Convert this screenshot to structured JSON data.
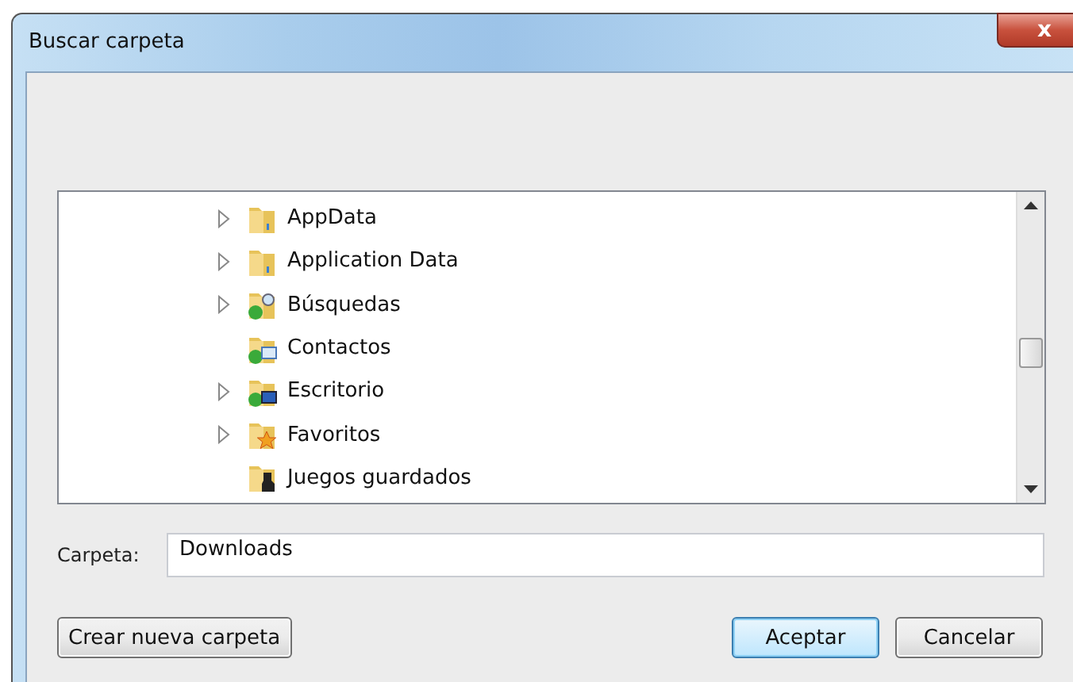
{
  "window": {
    "title": "Buscar carpeta",
    "close": "x"
  },
  "tree": {
    "items": [
      {
        "label": "AppData",
        "kind": "folder",
        "expandable": true
      },
      {
        "label": "Application Data",
        "kind": "folder",
        "expandable": true
      },
      {
        "label": "Búsquedas",
        "kind": "search",
        "expandable": true
      },
      {
        "label": "Contactos",
        "kind": "contacts",
        "expandable": false
      },
      {
        "label": "Escritorio",
        "kind": "desktop",
        "expandable": true
      },
      {
        "label": "Favoritos",
        "kind": "favorites",
        "expandable": true
      },
      {
        "label": "Juegos guardados",
        "kind": "games",
        "expandable": false
      }
    ]
  },
  "folder_field": {
    "label": "Carpeta:",
    "value": "Downloads"
  },
  "buttons": [
    {
      "label": "Crear nueva carpeta",
      "default": false
    },
    {
      "label": "Aceptar",
      "default": true
    },
    {
      "label": "Cancelar",
      "default": false
    }
  ]
}
